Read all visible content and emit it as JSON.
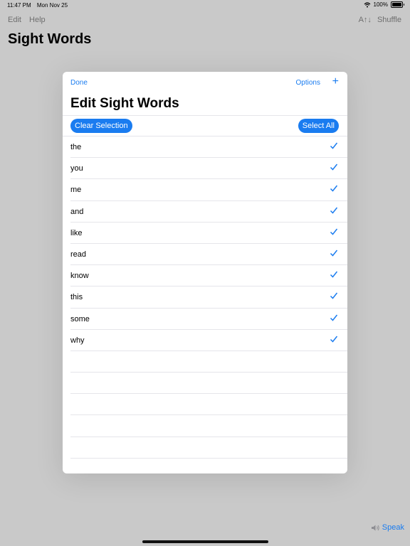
{
  "status": {
    "time": "11:47 PM",
    "date": "Mon Nov 25",
    "battery": "100%"
  },
  "menu": {
    "edit": "Edit",
    "help": "Help"
  },
  "toolbar": {
    "sort": "A↑↓",
    "shuffle": "Shuffle"
  },
  "app": {
    "title": "Sight Words"
  },
  "modal": {
    "done": "Done",
    "options": "Options",
    "add": "+",
    "title": "Edit Sight Words",
    "clear_selection": "Clear Selection",
    "select_all": "Select All",
    "words": [
      "the",
      "you",
      "me",
      "and",
      "like",
      "read",
      "know",
      "this",
      "some",
      "why"
    ]
  },
  "bottom": {
    "speak": "Speak"
  },
  "colors": {
    "accent": "#1a7cf0"
  }
}
